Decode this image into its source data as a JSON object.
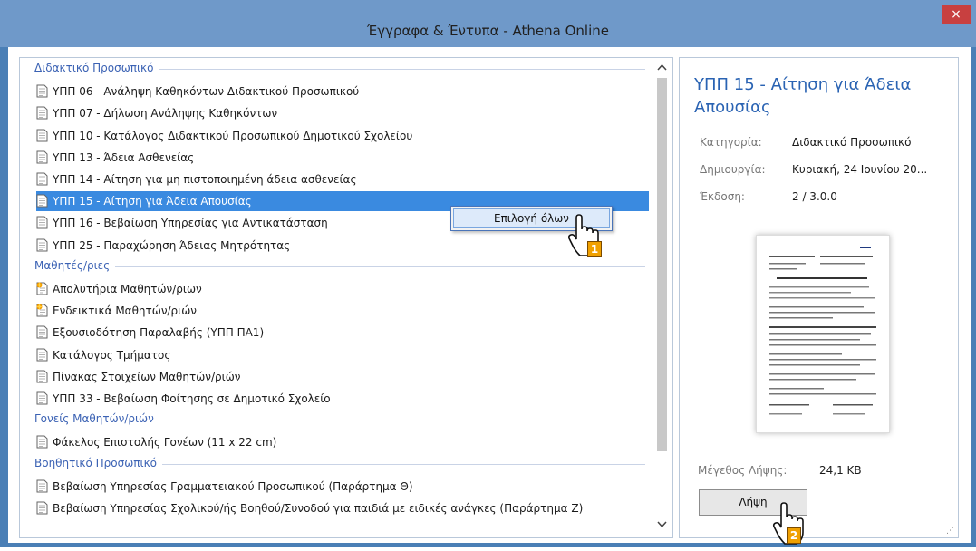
{
  "window": {
    "title": "Έγγραφα & Έντυπα - Athena Online",
    "close_glyph": "×"
  },
  "list": {
    "groups": [
      {
        "label": "Διδακτικό Προσωπικό",
        "items": [
          "ΥΠΠ 06 - Ανάληψη Καθηκόντων Διδακτικού Προσωπικού",
          "ΥΠΠ 07 - Δήλωση Ανάληψης Καθηκόντων",
          "ΥΠΠ 10 - Κατάλογος Διδακτικού Προσωπικού Δημοτικού Σχολείου",
          "ΥΠΠ 13 - Άδεια Ασθενείας",
          "ΥΠΠ 14 - Αίτηση για μη πιστοποιημένη άδεια ασθενείας",
          "ΥΠΠ 15 - Αίτηση για Άδεια Απουσίας",
          "ΥΠΠ 16 - Βεβαίωση Υπηρεσίας για Αντικατάσταση",
          "ΥΠΠ 25 - Παραχώρηση Άδειας Μητρότητας"
        ]
      },
      {
        "label": "Μαθητές/ριες",
        "items": [
          "Απολυτήρια Μαθητών/ριων",
          "Ενδεικτικά Μαθητών/ριών",
          "Εξουσιοδότηση Παραλαβής (ΥΠΠ ΠΑ1)",
          "Κατάλογος Τμήματος",
          "Πίνακας Στοιχείων Μαθητών/ριών",
          "ΥΠΠ 33 - Βεβαίωση Φοίτησης σε Δημοτικό Σχολείο"
        ]
      },
      {
        "label": "Γονείς Μαθητών/ριών",
        "items": [
          "Φάκελος Επιστολής Γονέων (11 x 22 cm)"
        ]
      },
      {
        "label": "Βοηθητικό Προσωπικό",
        "items": [
          "Βεβαίωση Υπηρεσίας Γραμματειακού Προσωπικού (Παράρτημα Θ)",
          "Βεβαίωση Υπηρεσίας Σχολικού/ής Βοηθού/Συνοδού για παιδιά με ειδικές ανάγκες (Παράρτημα Ζ)"
        ]
      }
    ],
    "selected_item": "ΥΠΠ 15 - Αίτηση για Άδεια Απουσίας",
    "certificate_items": [
      "Απολυτήρια Μαθητών/ριων",
      "Ενδεικτικά Μαθητών/ριών"
    ]
  },
  "context_menu": {
    "item": "Επιλογή όλων",
    "step_marker": "1"
  },
  "detail": {
    "title": "ΥΠΠ 15 - Αίτηση για Άδεια Απουσίας",
    "category_label": "Κατηγορία:",
    "category_value": "Διδακτικό Προσωπικό",
    "created_label": "Δημιουργία:",
    "created_value": "Κυριακή, 24 Ιουνίου 20...",
    "version_label": "Έκδοση:",
    "version_value": "2 / 3.0.0",
    "size_label": "Μέγεθος Λήψης:",
    "size_value": "24,1 KB",
    "download_label": "Λήψη",
    "download_step_marker": "2"
  },
  "colors": {
    "accent": "#2a63b3",
    "selection": "#3a8ae0",
    "step_marker": "#f0a000"
  }
}
